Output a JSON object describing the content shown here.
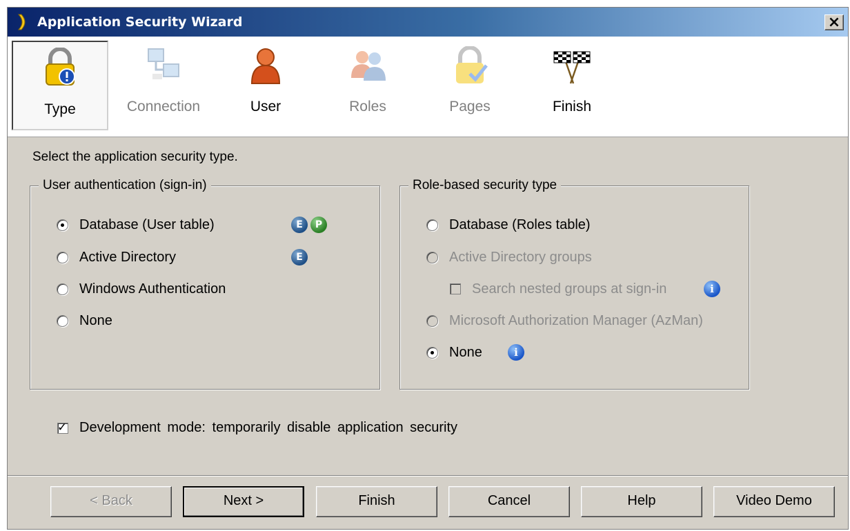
{
  "window": {
    "title": "Application Security Wizard"
  },
  "steps": [
    {
      "label": "Type",
      "icon": "lock-warning-icon",
      "state": "active"
    },
    {
      "label": "Connection",
      "icon": "network-computers-icon",
      "state": "disabled"
    },
    {
      "label": "User",
      "icon": "user-icon",
      "state": "enabled"
    },
    {
      "label": "Roles",
      "icon": "roles-users-icon",
      "state": "disabled"
    },
    {
      "label": "Pages",
      "icon": "lock-check-icon",
      "state": "disabled"
    },
    {
      "label": "Finish",
      "icon": "checkered-flags-icon",
      "state": "enabled"
    }
  ],
  "instruction": "Select the application security type.",
  "user_auth": {
    "legend": "User authentication (sign-in)",
    "options": [
      {
        "label": "Database (User table)",
        "selected": true,
        "badges": [
          "E",
          "P"
        ]
      },
      {
        "label": "Active Directory",
        "selected": false,
        "badges": [
          "E"
        ]
      },
      {
        "label": "Windows Authentication",
        "selected": false
      },
      {
        "label": "None",
        "selected": false
      }
    ]
  },
  "role_security": {
    "legend": "Role-based security type",
    "options": [
      {
        "label": "Database (Roles table)",
        "selected": false,
        "enabled": true
      },
      {
        "label": "Active Directory groups",
        "selected": false,
        "enabled": false
      },
      {
        "label": "Microsoft Authorization Manager (AzMan)",
        "selected": false,
        "enabled": false
      },
      {
        "label": "None",
        "selected": true,
        "enabled": true,
        "info": "i"
      }
    ],
    "nested_groups": {
      "label": "Search nested groups at sign-in",
      "checked": false,
      "enabled": false,
      "info": "i"
    }
  },
  "dev_mode": {
    "label": "Development mode: temporarily disable application security",
    "checked": true,
    "check_glyph": "✓"
  },
  "buttons": {
    "back": "< Back",
    "next": "Next >",
    "finish": "Finish",
    "cancel": "Cancel",
    "help": "Help",
    "video_demo": "Video Demo"
  },
  "close_glyph": "×",
  "colors": {
    "title_gradient_start": "#0a246a",
    "title_gradient_end": "#a6caf0",
    "dialog_face": "#d4d0c8",
    "badge_e": "#1f4f86",
    "badge_p": "#2a7f25",
    "badge_info": "#1a56c8"
  }
}
